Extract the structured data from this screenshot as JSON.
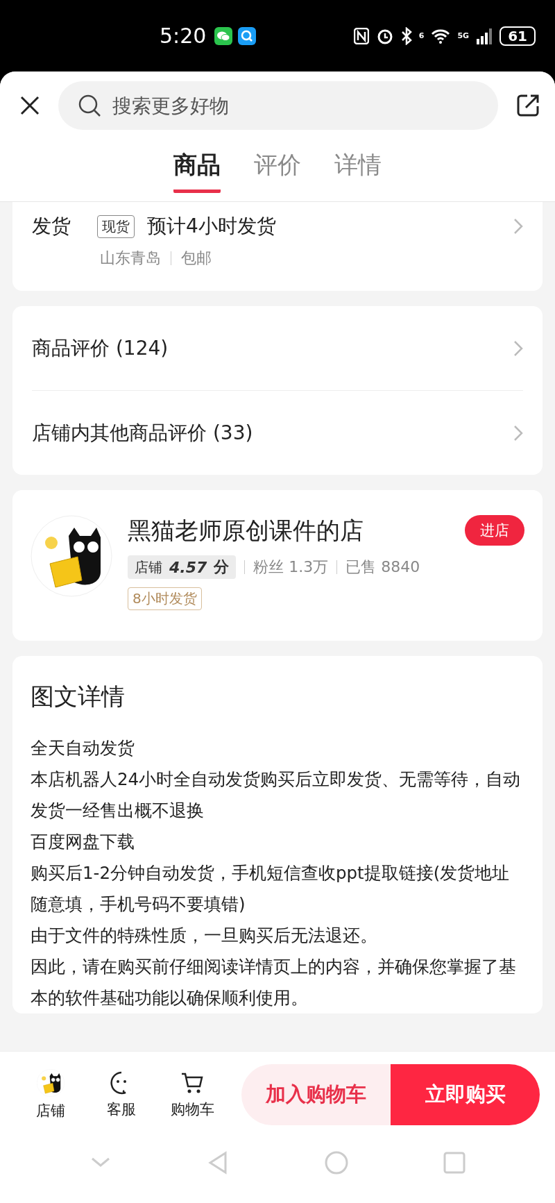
{
  "status_bar": {
    "time": "5:20",
    "wifi_label": "6",
    "network": "5G",
    "battery": "61"
  },
  "header": {
    "search": {
      "placeholder": "搜索更多好物"
    }
  },
  "tabs": [
    {
      "label": "商品",
      "selected": true
    },
    {
      "label": "评价",
      "selected": false
    },
    {
      "label": "详情",
      "selected": false
    }
  ],
  "shipping": {
    "label": "发货",
    "tag": "现货",
    "estimate": "预计4小时发货",
    "origin": "山东青岛",
    "fee": "包邮"
  },
  "reviews": [
    {
      "label": "商品评价 (124)"
    },
    {
      "label": "店铺内其他商品评价 (33)"
    }
  ],
  "shop": {
    "name": "黑猫老师原创课件的店",
    "enter": "进店",
    "rating_label": "店铺",
    "score": "4.57",
    "score_unit": "分",
    "fans": "粉丝 1.3万",
    "sold": "已售 8840",
    "badge": "8小时发货"
  },
  "details": {
    "title": "图文详情",
    "paragraphs": [
      "全天自动发货",
      "本店机器人24小时全自动发货购买后立即发货、无需等待，自动发货一经售出概不退换",
      "百度网盘下载",
      "购买后1-2分钟自动发货，手机短信查收ppt提取链接(发货地址随意填，手机号码不要填错)",
      "由于文件的特殊性质，一旦购买后无法退还。",
      "因此，请在购买前仔细阅读详情页上的内容，并确保您掌握了基本的软件基础功能以确保顺利使用。"
    ]
  },
  "bottom_bar": {
    "items": [
      {
        "kind": "shop",
        "label": "店铺"
      },
      {
        "kind": "service",
        "label": "客服"
      },
      {
        "kind": "cart",
        "label": "购物车"
      }
    ],
    "add_to_cart": "加入购物车",
    "buy_now": "立即购买"
  }
}
